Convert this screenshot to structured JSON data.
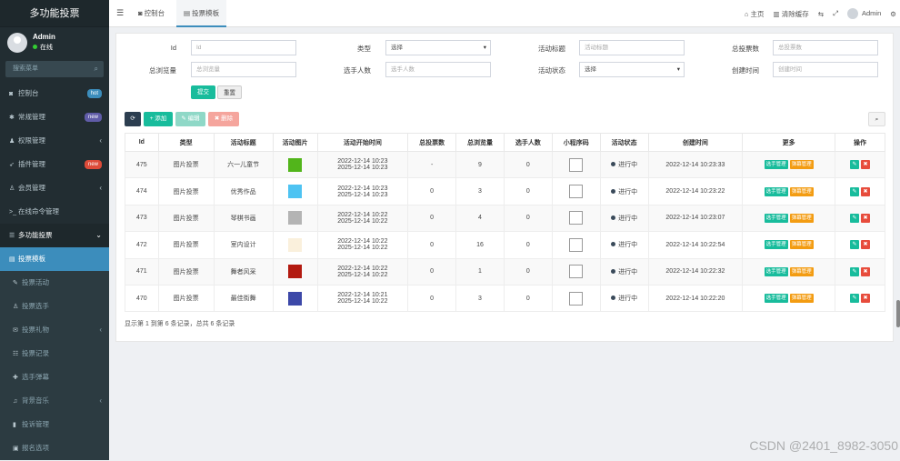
{
  "brand": "多功能投票",
  "user": {
    "name": "Admin",
    "status": "在线"
  },
  "sidebar_search": {
    "placeholder": "搜索菜单"
  },
  "menu": [
    {
      "icon": "dashboard-icon",
      "glyph": "◙",
      "label": "控制台",
      "badge": "hot",
      "badge_color": "#3c8dbc"
    },
    {
      "icon": "gears-icon",
      "glyph": "✱",
      "label": "常规管理",
      "badge": "new",
      "badge_color": "#605ca8"
    },
    {
      "icon": "user-group-icon",
      "glyph": "♟",
      "label": "权限管理",
      "arrow": "‹"
    },
    {
      "icon": "rocket-icon",
      "glyph": "➶",
      "label": "插件管理",
      "badge": "new",
      "badge_color": "#dd4b39"
    },
    {
      "icon": "user-icon",
      "glyph": "♙",
      "label": "会员管理",
      "arrow": "‹"
    },
    {
      "icon": "terminal-icon",
      "glyph": ">_",
      "label": "在线命令管理"
    },
    {
      "icon": "list-icon",
      "glyph": "☰",
      "label": "多功能投票",
      "arrow": "⌄",
      "state": "open"
    },
    {
      "icon": "template-icon",
      "glyph": "▤",
      "label": "投票模板",
      "state": "active"
    },
    {
      "icon": "vote-icon",
      "glyph": "✎",
      "label": "投票活动",
      "state": "sub"
    },
    {
      "icon": "contestant-icon",
      "glyph": "♙",
      "label": "投票选手",
      "state": "sub"
    },
    {
      "icon": "gift-icon",
      "glyph": "✉",
      "label": "投票礼物",
      "state": "sub",
      "arrow": "‹"
    },
    {
      "icon": "record-icon",
      "glyph": "☷",
      "label": "投票记录",
      "state": "sub"
    },
    {
      "icon": "danmaku-icon",
      "glyph": "✚",
      "label": "选手弹幕",
      "state": "sub"
    },
    {
      "icon": "music-icon",
      "glyph": "♫",
      "label": "背景音乐",
      "state": "sub",
      "arrow": "‹"
    },
    {
      "icon": "report-icon",
      "glyph": "▮",
      "label": "投诉管理",
      "state": "sub"
    },
    {
      "icon": "option-icon",
      "glyph": "▣",
      "label": "报名选项",
      "state": "sub"
    }
  ],
  "topbar": {
    "tabs": [
      {
        "label": "控制台"
      },
      {
        "label": "投票模板"
      }
    ],
    "home": "主页",
    "clear_cache": "清除缓存",
    "admin": "Admin"
  },
  "filters": {
    "id": {
      "label": "Id",
      "placeholder": "Id"
    },
    "type": {
      "label": "类型",
      "value": "选择"
    },
    "title": {
      "label": "活动标题",
      "placeholder": "活动标题"
    },
    "total_votes": {
      "label": "总投票数",
      "placeholder": "总投票数"
    },
    "total_views": {
      "label": "总浏览量",
      "placeholder": "总浏览量"
    },
    "players": {
      "label": "选手人数",
      "placeholder": "选手人数"
    },
    "status": {
      "label": "活动状态",
      "value": "选择"
    },
    "created": {
      "label": "创建时间",
      "placeholder": "创建时间"
    },
    "submit": "提交",
    "reset": "重置"
  },
  "toolbar": {
    "add": "添加",
    "edit": "编辑",
    "delete": "删除"
  },
  "table": {
    "headers": [
      "Id",
      "类型",
      "活动标题",
      "活动图片",
      "活动开始时间",
      "总投票数",
      "总浏览量",
      "选手人数",
      "小程序码",
      "活动状态",
      "创建时间",
      "更多",
      "操作"
    ],
    "rows": [
      {
        "id": "475",
        "type": "图片投票",
        "title": "六一儿童节",
        "color": "#52b51b",
        "start": "2022-12-14 10:23",
        "end": "2025-12-14 10:23",
        "votes": "-",
        "views": "9",
        "players": "0",
        "status": "进行中",
        "created": "2022-12-14 10:23:33"
      },
      {
        "id": "474",
        "type": "图片投票",
        "title": "优秀作品",
        "color": "#4ec3f2",
        "start": "2022-12-14 10:23",
        "end": "2025-12-14 10:23",
        "votes": "0",
        "views": "3",
        "players": "0",
        "status": "进行中",
        "created": "2022-12-14 10:23:22"
      },
      {
        "id": "473",
        "type": "图片投票",
        "title": "琴棋书画",
        "color": "#b4b4b4",
        "start": "2022-12-14 10:22",
        "end": "2025-12-14 10:22",
        "votes": "0",
        "views": "4",
        "players": "0",
        "status": "进行中",
        "created": "2022-12-14 10:23:07"
      },
      {
        "id": "472",
        "type": "图片投票",
        "title": "室内设计",
        "color": "#faf0dc",
        "start": "2022-12-14 10:22",
        "end": "2025-12-14 10:22",
        "votes": "0",
        "views": "16",
        "players": "0",
        "status": "进行中",
        "created": "2022-12-14 10:22:54"
      },
      {
        "id": "471",
        "type": "图片投票",
        "title": "舞者风采",
        "color": "#b31a10",
        "start": "2022-12-14 10:22",
        "end": "2025-12-14 10:22",
        "votes": "0",
        "views": "1",
        "players": "0",
        "status": "进行中",
        "created": "2022-12-14 10:22:32"
      },
      {
        "id": "470",
        "type": "图片投票",
        "title": "最佳街舞",
        "color": "#3c48a8",
        "start": "2022-12-14 10:21",
        "end": "2025-12-14 10:22",
        "votes": "0",
        "views": "3",
        "players": "0",
        "status": "进行中",
        "created": "2022-12-14 10:22:20"
      }
    ],
    "more_btn1": "选手管理",
    "more_btn2": "弹幕管理"
  },
  "footer_text": "显示第 1 到第 6 条记录，总共 6 条记录",
  "watermark": "CSDN @2401_8982-3050",
  "colors": {
    "sidebar": "#222d32",
    "accent": "#3c8dbc",
    "green": "#18bc9c",
    "orange": "#f39c12",
    "red": "#e74c3c"
  }
}
